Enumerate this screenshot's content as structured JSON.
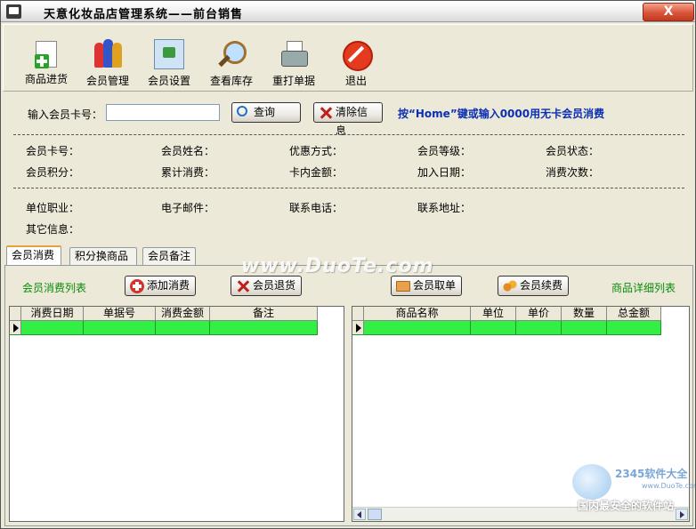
{
  "window": {
    "title": "天意化妆品店管理系统——前台销售",
    "close_label": "X"
  },
  "toolbar": [
    {
      "label": "商品进货",
      "icon": "add-file-icon"
    },
    {
      "label": "会员管理",
      "icon": "members-icon"
    },
    {
      "label": "会员设置",
      "icon": "settings-box-icon"
    },
    {
      "label": "查看库存",
      "icon": "magnifier-icon"
    },
    {
      "label": "重打单据",
      "icon": "printer-icon"
    },
    {
      "label": "退出",
      "icon": "exit-icon"
    }
  ],
  "search": {
    "card_label": "输入会员卡号：",
    "card_value": "",
    "query_button": "查询",
    "clear_button": "清除信息",
    "hint": "按“Home”键或输入0000用无卡会员消费"
  },
  "member_info": {
    "row1": [
      "会员卡号：",
      "会员姓名：",
      "优惠方式：",
      "会员等级：",
      "会员状态："
    ],
    "row2": [
      "会员积分：",
      "累计消费：",
      "卡内金额：",
      "加入日期：",
      "消费次数："
    ],
    "row3": [
      "单位职业：",
      "电子邮件：",
      "联系电话：",
      "联系地址："
    ],
    "row4": [
      "其它信息："
    ]
  },
  "tabs": [
    "会员消费",
    "积分换商品",
    "会员备注"
  ],
  "panel": {
    "left_title": "会员消费列表",
    "right_title": "商品详细列表",
    "buttons": {
      "add": "添加消费",
      "refund": "会员退货",
      "retrieve": "会员取单",
      "renew": "会员续费"
    }
  },
  "left_grid": {
    "columns": [
      "消费日期",
      "单据号",
      "消费金额",
      "备注"
    ]
  },
  "right_grid": {
    "columns": [
      "商品名称",
      "单位",
      "单价",
      "数量",
      "总金额"
    ]
  },
  "watermark": "www.DuoTe.com",
  "logo": {
    "brand": "2345软件大全",
    "url": "www.DuoTe.com",
    "slogan": "国内最安全的软件站"
  }
}
